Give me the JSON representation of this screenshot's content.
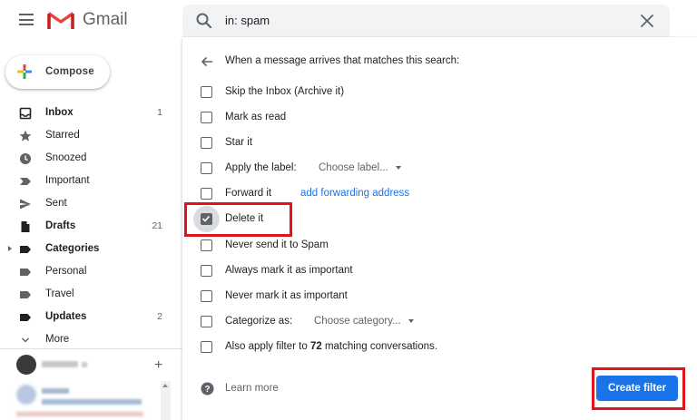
{
  "app": {
    "name": "Gmail"
  },
  "search": {
    "query": "in: spam"
  },
  "compose": {
    "label": "Compose"
  },
  "sidebar": {
    "items": [
      {
        "label": "Inbox",
        "count": "1",
        "bold": true,
        "icon": "inbox-icon"
      },
      {
        "label": "Starred",
        "count": "",
        "bold": false,
        "icon": "star-icon"
      },
      {
        "label": "Snoozed",
        "count": "",
        "bold": false,
        "icon": "clock-icon"
      },
      {
        "label": "Important",
        "count": "",
        "bold": false,
        "icon": "important-icon"
      },
      {
        "label": "Sent",
        "count": "",
        "bold": false,
        "icon": "send-icon"
      },
      {
        "label": "Drafts",
        "count": "21",
        "bold": true,
        "icon": "draft-icon"
      },
      {
        "label": "Categories",
        "count": "",
        "bold": true,
        "icon": "label-icon"
      },
      {
        "label": "Personal",
        "count": "",
        "bold": false,
        "icon": "label-icon"
      },
      {
        "label": "Travel",
        "count": "",
        "bold": false,
        "icon": "label-icon"
      },
      {
        "label": "Updates",
        "count": "2",
        "bold": true,
        "icon": "label-icon"
      },
      {
        "label": "More",
        "count": "",
        "bold": false,
        "icon": "chevron-down-icon"
      }
    ],
    "add_hangout_symbol": "+"
  },
  "filter_dialog": {
    "header": "When a message arrives that matches this search:",
    "options": {
      "skip_inbox": "Skip the Inbox (Archive it)",
      "mark_read": "Mark as read",
      "star": "Star it",
      "apply_label": "Apply the label:",
      "choose_label": "Choose label...",
      "forward": "Forward it",
      "add_forwarding": "add forwarding address",
      "delete": "Delete it",
      "never_spam": "Never send it to Spam",
      "always_important": "Always mark it as important",
      "never_important": "Never mark it as important",
      "categorize": "Categorize as:",
      "choose_category": "Choose category...",
      "also_apply_prefix": "Also apply filter to ",
      "also_apply_count": "72",
      "also_apply_suffix": " matching conversations."
    },
    "checked": [
      "delete"
    ],
    "learn_more": "Learn more",
    "create_button": "Create filter"
  },
  "colors": {
    "accent": "#1a73e8",
    "highlight": "#e0151c",
    "icon_gray": "#5f6368"
  }
}
